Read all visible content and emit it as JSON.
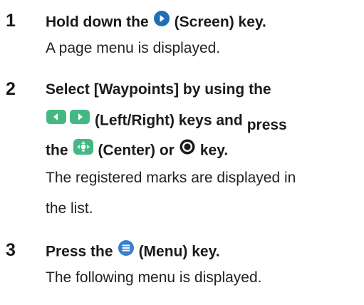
{
  "steps": [
    {
      "number": "1",
      "instruction": {
        "before": "Hold down the",
        "after": "(Screen) key."
      },
      "result": "A page menu is displayed.",
      "icons": [
        "screen-key-icon"
      ]
    },
    {
      "number": "2",
      "instruction": {
        "line1": "Select [Waypoints] by using the",
        "line2_after_icons": "(Left/Right) keys and",
        "line2_tail": "press",
        "line3_before": "the",
        "line3_mid": "(Center) or",
        "line3_after": "key."
      },
      "result_lines": [
        "The registered marks are displayed in",
        "the list."
      ],
      "icons": [
        "left-key-icon",
        "right-key-icon",
        "center-key-icon",
        "enter-key-icon"
      ]
    },
    {
      "number": "3",
      "instruction": {
        "before": "Press the",
        "after": "(Menu) key."
      },
      "result": "The following menu is displayed.",
      "icons": [
        "menu-key-icon"
      ]
    }
  ],
  "colors": {
    "screen_key": "#1e6fb5",
    "arrow_keys": "#43b882",
    "center_key": "#43b882",
    "menu_key": "#3a7fd0",
    "enter_key": "#1a1a1a"
  }
}
